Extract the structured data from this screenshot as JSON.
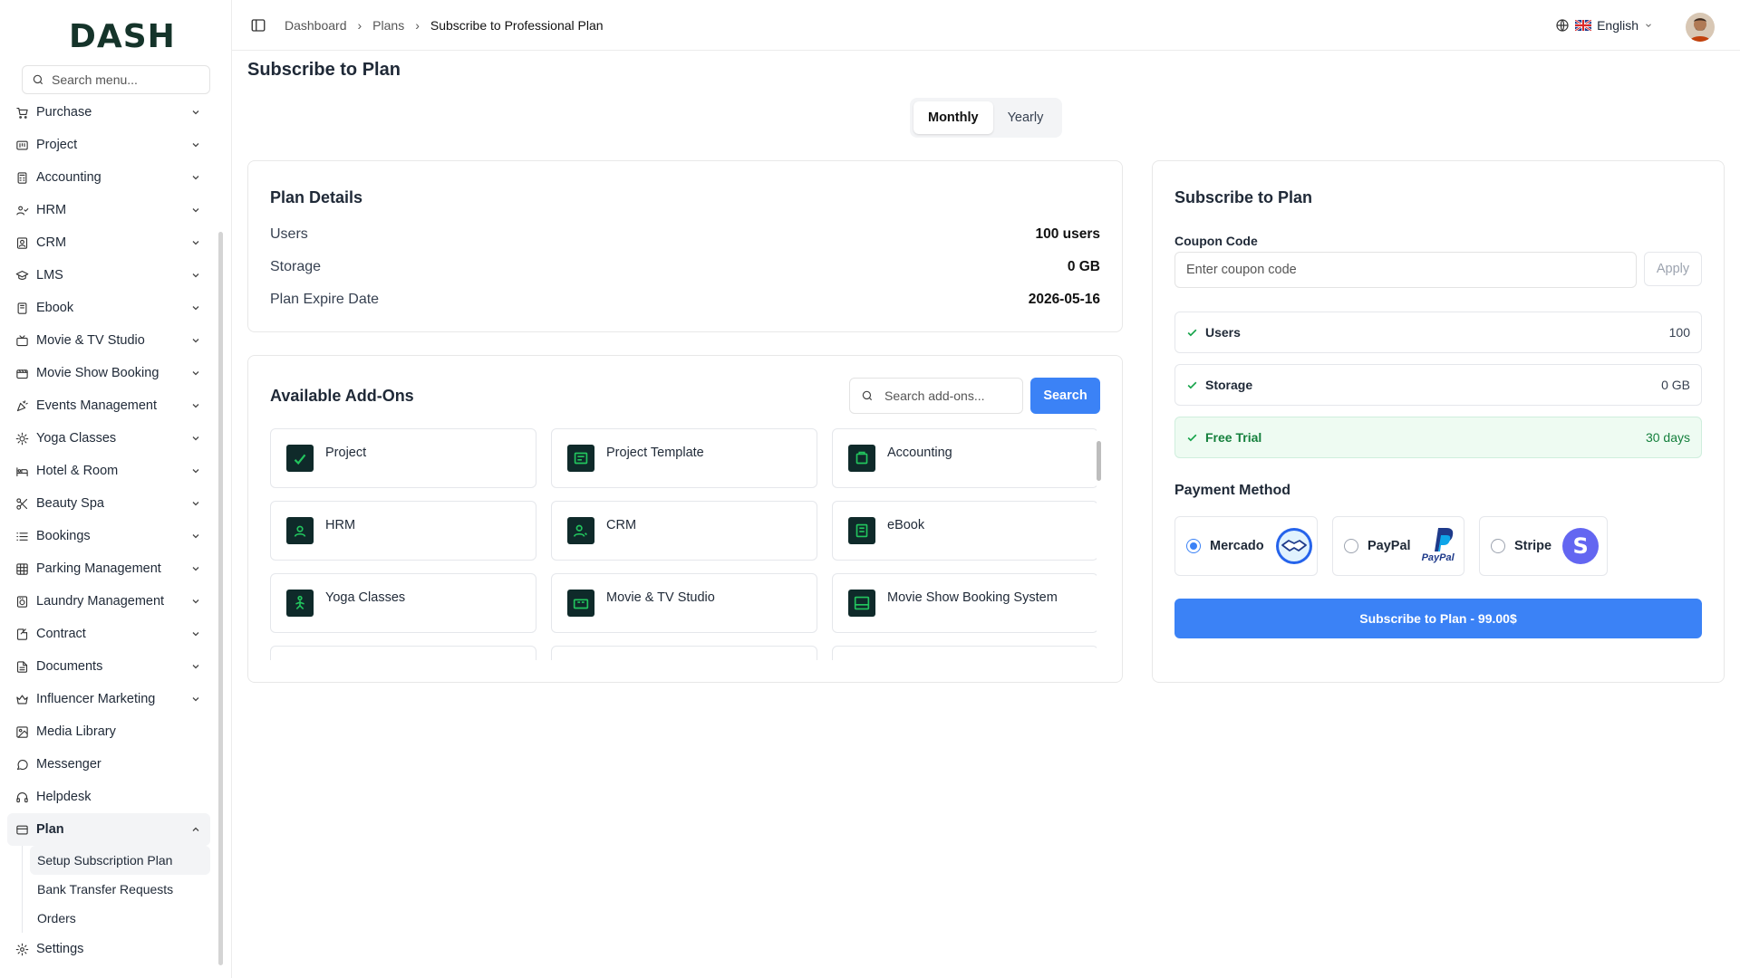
{
  "app": {
    "logo_text": "DASH"
  },
  "sidebar": {
    "search_placeholder": "Search menu...",
    "items": [
      {
        "label": "Purchase",
        "icon": "cart-icon"
      },
      {
        "label": "Project",
        "icon": "project-icon"
      },
      {
        "label": "Accounting",
        "icon": "calculator-icon"
      },
      {
        "label": "HRM",
        "icon": "users-icon"
      },
      {
        "label": "CRM",
        "icon": "contact-icon"
      },
      {
        "label": "LMS",
        "icon": "graduation-icon"
      },
      {
        "label": "Ebook",
        "icon": "book-icon"
      },
      {
        "label": "Movie & TV Studio",
        "icon": "tv-icon"
      },
      {
        "label": "Movie Show Booking",
        "icon": "film-icon"
      },
      {
        "label": "Events Management",
        "icon": "party-icon"
      },
      {
        "label": "Yoga Classes",
        "icon": "sun-icon"
      },
      {
        "label": "Hotel & Room",
        "icon": "bed-icon"
      },
      {
        "label": "Beauty Spa",
        "icon": "scissors-icon"
      },
      {
        "label": "Bookings",
        "icon": "list-icon"
      },
      {
        "label": "Parking Management",
        "icon": "grid-icon"
      },
      {
        "label": "Laundry Management",
        "icon": "washer-icon"
      },
      {
        "label": "Contract",
        "icon": "contract-icon"
      },
      {
        "label": "Documents",
        "icon": "document-icon"
      },
      {
        "label": "Influencer Marketing",
        "icon": "crown-icon"
      },
      {
        "label": "Media Library",
        "icon": "image-icon"
      },
      {
        "label": "Messenger",
        "icon": "chat-icon"
      },
      {
        "label": "Helpdesk",
        "icon": "headset-icon"
      },
      {
        "label": "Plan",
        "icon": "credit-card-icon"
      }
    ],
    "plan_sub": [
      "Setup Subscription Plan",
      "Bank Transfer Requests",
      "Orders"
    ],
    "settings_label": "Settings"
  },
  "header": {
    "breadcrumbs": [
      "Dashboard",
      "Plans",
      "Subscribe to Professional Plan"
    ],
    "language": "English",
    "flag": "uk-flag"
  },
  "page": {
    "title": "Subscribe to Plan",
    "period_tabs": [
      "Monthly",
      "Yearly"
    ]
  },
  "plan_details": {
    "title": "Plan Details",
    "rows": [
      {
        "label": "Users",
        "value": "100 users"
      },
      {
        "label": "Storage",
        "value": "0 GB"
      },
      {
        "label": "Plan Expire Date",
        "value": "2026-05-16"
      }
    ]
  },
  "addons": {
    "title": "Available Add-Ons",
    "search_placeholder": "Search add-ons...",
    "search_button": "Search",
    "items": [
      "Project",
      "Project Template",
      "Accounting",
      "HRM",
      "CRM",
      "eBook",
      "Yoga Classes",
      "Movie & TV Studio",
      "Movie Show Booking System"
    ]
  },
  "subscribe": {
    "title": "Subscribe to Plan",
    "coupon_label": "Coupon Code",
    "coupon_placeholder": "Enter coupon code",
    "apply_label": "Apply",
    "summary": [
      {
        "label": "Users",
        "value": "100"
      },
      {
        "label": "Storage",
        "value": "0 GB"
      },
      {
        "label": "Free Trial",
        "value": "30 days"
      }
    ],
    "payment_label": "Payment Method",
    "payment_methods": [
      {
        "name": "Mercado",
        "selected": true
      },
      {
        "name": "PayPal",
        "selected": false
      },
      {
        "name": "Stripe",
        "selected": false
      }
    ],
    "paypal_logo_text": "PayPal",
    "stripe_logo_text": "S",
    "button_label": "Subscribe to Plan - 99.00$"
  },
  "colors": {
    "primary": "#3b82f6",
    "success": "#15803d",
    "addon_icon_bg": "#0f2a2a",
    "addon_icon_fg": "#22c55e"
  }
}
